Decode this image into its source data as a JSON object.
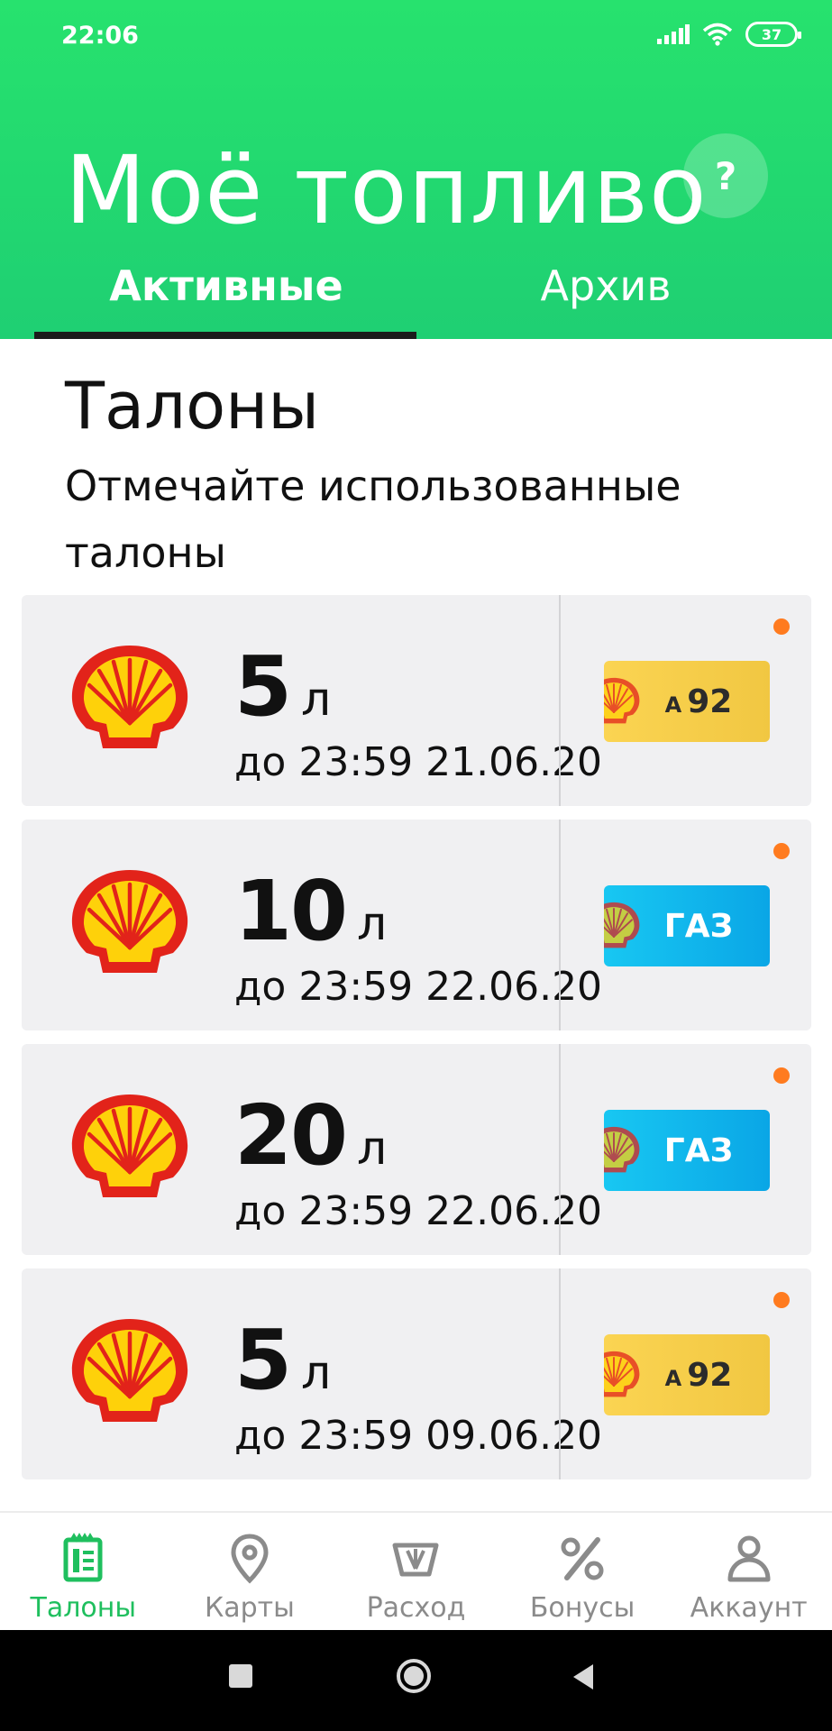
{
  "status_bar": {
    "time": "22:06",
    "battery": "37"
  },
  "header": {
    "title": "Моё топливо",
    "help": "?"
  },
  "tabs": [
    {
      "label": "Активные",
      "active": true
    },
    {
      "label": "Архив",
      "active": false
    }
  ],
  "section": {
    "title": "Талоны",
    "subtitle": "Отмечайте использованные талоны"
  },
  "coupons": [
    {
      "volume": "5",
      "unit": "л",
      "expiry": "до 23:59 21.06.20",
      "fuel_prefix": "A",
      "fuel": "92",
      "badge_color": "#f7ce4a"
    },
    {
      "volume": "10",
      "unit": "л",
      "expiry": "до 23:59 22.06.20",
      "fuel_prefix": "",
      "fuel": "ГАЗ",
      "badge_color": "#12b8ee"
    },
    {
      "volume": "20",
      "unit": "л",
      "expiry": "до 23:59 22.06.20",
      "fuel_prefix": "",
      "fuel": "ГАЗ",
      "badge_color": "#12b8ee"
    },
    {
      "volume": "5",
      "unit": "л",
      "expiry": "до 23:59 09.06.20",
      "fuel_prefix": "A",
      "fuel": "92",
      "badge_color": "#f7ce4a"
    }
  ],
  "bottom_nav": [
    {
      "label": "Талоны",
      "icon": "coupon-icon",
      "active": true
    },
    {
      "label": "Карты",
      "icon": "map-pin-icon",
      "active": false
    },
    {
      "label": "Расход",
      "icon": "gauge-icon",
      "active": false
    },
    {
      "label": "Бонусы",
      "icon": "percent-icon",
      "active": false
    },
    {
      "label": "Аккаунт",
      "icon": "user-icon",
      "active": false
    }
  ],
  "colors": {
    "header_green": "#27e26e",
    "accent_green": "#1fbf5e",
    "status_dot": "#ff7b1f"
  }
}
